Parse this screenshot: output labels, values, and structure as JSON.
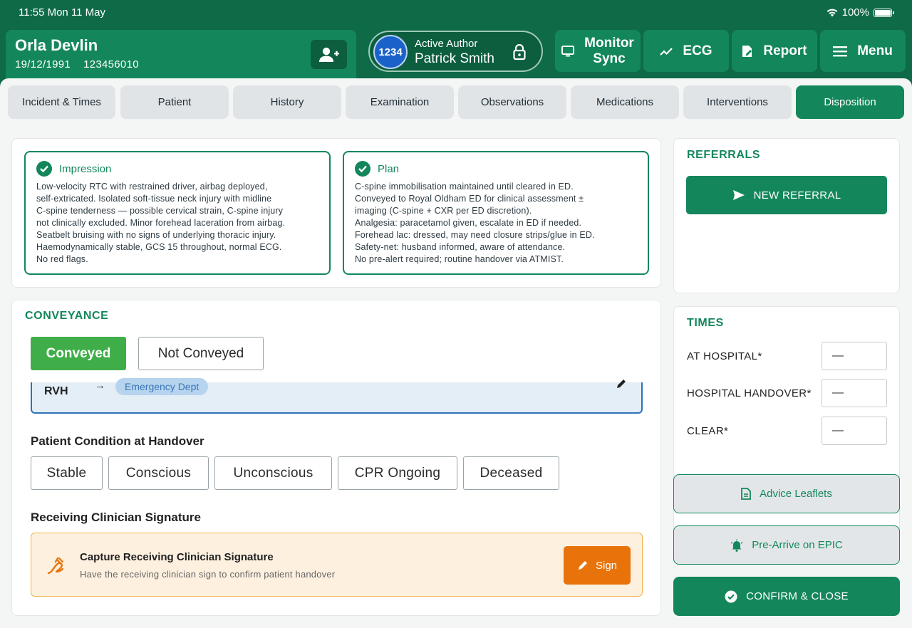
{
  "status_bar": {
    "time_date": "11:55  Mon 11 May",
    "battery": "100%"
  },
  "patient": {
    "name": "Orla Devlin",
    "dob": "19/12/1991",
    "id": "123456010"
  },
  "author": {
    "badge": "1234",
    "role": "Active Author",
    "name": "Patrick Smith"
  },
  "header_buttons": {
    "monitor_sync": "Monitor\nSync",
    "ecg": "ECG",
    "report": "Report",
    "menu": "Menu"
  },
  "tabs": [
    {
      "label": "Incident & Times"
    },
    {
      "label": "Patient"
    },
    {
      "label": "History"
    },
    {
      "label": "Examination"
    },
    {
      "label": "Observations"
    },
    {
      "label": "Medications"
    },
    {
      "label": "Interventions"
    },
    {
      "label": "Disposition",
      "active": true
    }
  ],
  "impression": {
    "title": "Impression",
    "text": "Low-velocity RTC with restrained driver, airbag deployed,\nself-extricated. Isolated soft-tissue neck injury with midline\nC-spine tenderness — possible cervical strain, C-spine injury\nnot clinically excluded. Minor forehead laceration from airbag.\nSeatbelt bruising with no signs of underlying thoracic injury.\nHaemodynamically stable, GCS 15 throughout, normal ECG.\nNo red flags."
  },
  "plan": {
    "title": "Plan",
    "text": "C-spine immobilisation maintained until cleared in ED.\nConveyed to Royal Oldham ED for clinical assessment ±\nimaging (C-spine + CXR per ED discretion).\nAnalgesia: paracetamol given, escalate in ED if needed.\nForehead lac: dressed, may need closure strips/glue in ED.\nSafety-net: husband informed, aware of attendance.\nNo pre-alert required; routine handover via ATMIST."
  },
  "conveyance": {
    "title": "CONVEYANCE",
    "options": [
      "Conveyed",
      "Not Conveyed"
    ],
    "selected": "Conveyed",
    "destination": {
      "hospital": "RVH",
      "arrow": "→",
      "department": "Emergency Dept"
    }
  },
  "handover_condition": {
    "title": "Patient Condition at Handover",
    "options": [
      "Stable",
      "Conscious",
      "Unconscious",
      "CPR Ongoing",
      "Deceased"
    ]
  },
  "signature": {
    "title": "Receiving Clinician Signature",
    "capture_title": "Capture Receiving Clinician Signature",
    "capture_sub": "Have the receiving clinician sign to confirm patient handover",
    "button": "Sign"
  },
  "referrals": {
    "title": "REFERRALS",
    "new_button": "NEW REFERRAL"
  },
  "times": {
    "title": "TIMES",
    "rows": [
      {
        "label": "AT HOSPITAL*",
        "value": "—"
      },
      {
        "label": "HOSPITAL HANDOVER*",
        "value": "—"
      },
      {
        "label": "CLEAR*",
        "value": "—"
      }
    ]
  },
  "actions": {
    "advice_leaflets": "Advice Leaflets",
    "pre_arrive": "Pre-Arrive on EPIC",
    "confirm_close": "CONFIRM & CLOSE"
  },
  "colors": {
    "primary": "#13875b",
    "primary_dark": "#0f6a48",
    "conveyed": "#3fae49",
    "sign": "#e8730b",
    "author_badge": "#1a62c9"
  }
}
